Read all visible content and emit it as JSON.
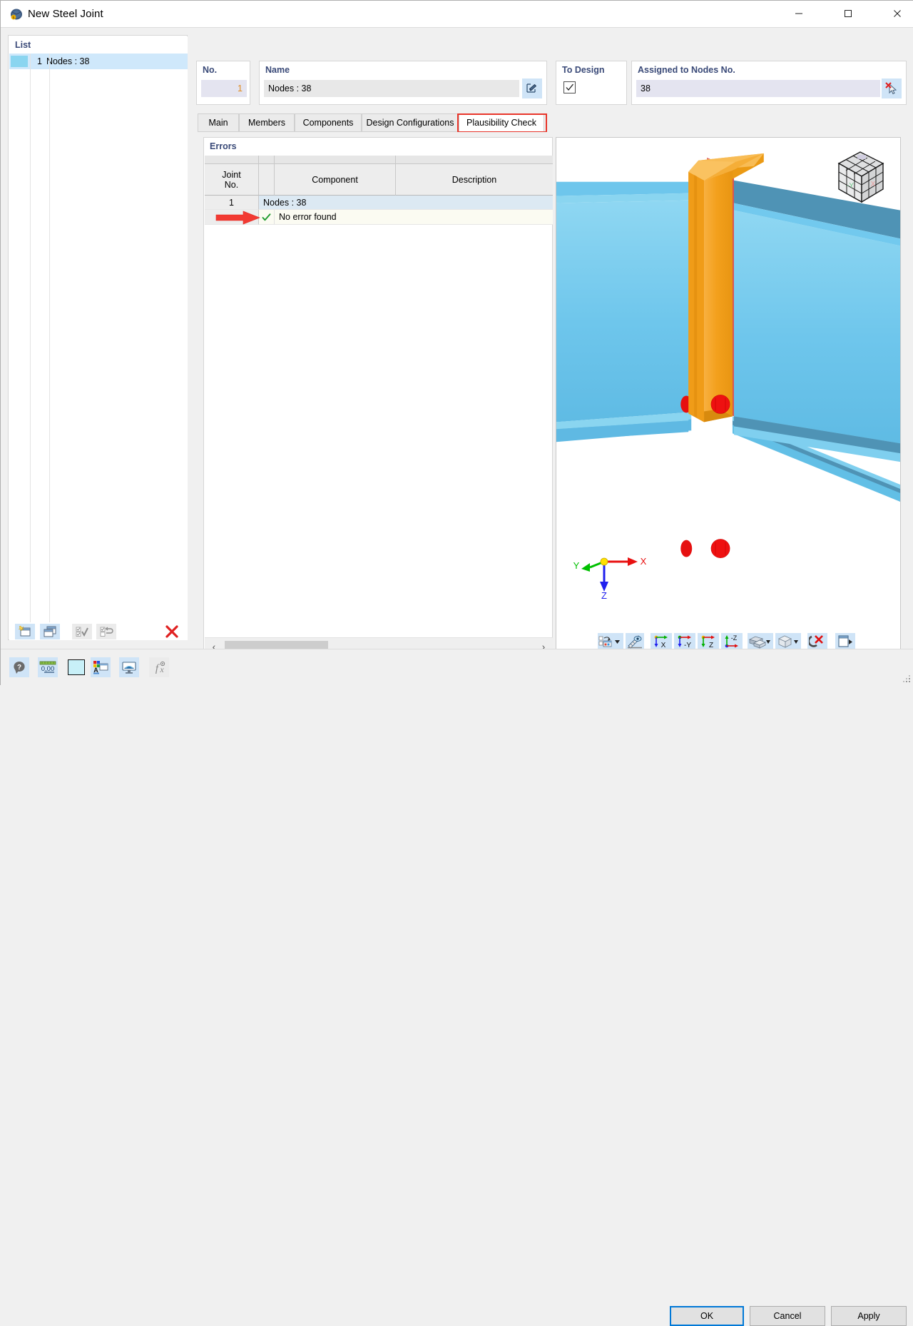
{
  "window": {
    "title": "New Steel Joint",
    "app_icon": "steel-joint-icon",
    "minimize_label": "─",
    "maximize_label": "☐",
    "close_label": "✕"
  },
  "list_panel": {
    "title": "List",
    "rows": [
      {
        "number": "1",
        "label": "Nodes : 38",
        "swatch_color": "#8ad5f0",
        "selected": true
      }
    ],
    "toolbar": [
      {
        "name": "new-joint-button",
        "icon": "new-window-icon",
        "enabled": true
      },
      {
        "name": "copy-joint-button",
        "icon": "copy-window-icon",
        "enabled": true
      },
      {
        "name": "select-all-button",
        "icon": "check-all-icon",
        "enabled": false
      },
      {
        "name": "invert-selection-button",
        "icon": "invert-selection-icon",
        "enabled": false
      },
      {
        "name": "delete-joint-button",
        "icon": "red-x-icon",
        "enabled": true
      }
    ]
  },
  "no_field": {
    "label": "No.",
    "value": "1"
  },
  "name_field": {
    "label": "Name",
    "value": "Nodes : 38",
    "edit_button_icon": "edit-pencil-icon"
  },
  "to_design": {
    "label": "To Design",
    "checked": true,
    "check_glyph": "✓"
  },
  "assigned_field": {
    "label": "Assigned to Nodes No.",
    "value": "38",
    "pick_button_icon": "pick-cursor-clear-icon"
  },
  "tabs": [
    {
      "label": "Main",
      "active": false
    },
    {
      "label": "Members",
      "active": false
    },
    {
      "label": "Components",
      "active": false
    },
    {
      "label": "Design Configurations",
      "active": false
    },
    {
      "label": "Plausibility Check",
      "active": true,
      "highlighted": true
    }
  ],
  "highlight_color": "#e8352a",
  "errors_panel": {
    "title": "Errors",
    "columns": [
      {
        "label": "Joint\nNo.",
        "line1": "Joint",
        "line2": "No."
      },
      {
        "label": ""
      },
      {
        "label": "Component"
      },
      {
        "label": "Description"
      }
    ],
    "rows": [
      {
        "type": "group",
        "joint_no": "1",
        "status_icon": "",
        "component": "Nodes : 38",
        "description": ""
      },
      {
        "type": "result",
        "joint_no": "",
        "status_icon": "green-check-icon",
        "status_glyph": "✔",
        "component": "No error found",
        "description": "",
        "annotation": "red-arrow-pointer"
      }
    ],
    "scroll_left_glyph": "‹",
    "scroll_right_glyph": "›"
  },
  "view3d": {
    "navigation_cube": "view-cube",
    "axis_labels": {
      "x": "X",
      "y": "Y",
      "z": "Z"
    },
    "axis_colors": {
      "x": "#e81010",
      "y": "#00c000",
      "z": "#2020ee"
    },
    "model": {
      "beam_color": "#6ec6ec",
      "beam_shade_color": "#4f93b5",
      "plate_color": "#f5a623",
      "bolt_color": "#ee1111",
      "weld_color": "#d9534f",
      "description": "Two blue I-beams meeting at right angle with orange end plate and red bolts"
    },
    "toolbar": [
      {
        "name": "display-properties-button",
        "icon": "display-properties-icon",
        "dropdown": true
      },
      {
        "name": "measure-button",
        "icon": "ruler-eye-icon",
        "dropdown": false
      },
      {
        "name": "view-in-x-button",
        "icon": "axis-x-icon",
        "label": "X",
        "dropdown": false
      },
      {
        "name": "view-in-y-button",
        "icon": "axis-y-icon",
        "label": "-Y",
        "dropdown": false
      },
      {
        "name": "view-in-z-button",
        "icon": "axis-z-icon",
        "label": "Z",
        "dropdown": false
      },
      {
        "name": "view-in-neg-z-button",
        "icon": "axis-neg-z-icon",
        "label": "-Z",
        "dropdown": false
      },
      {
        "name": "render-mode-button",
        "icon": "solid-blocks-icon",
        "dropdown": true
      },
      {
        "name": "projection-button",
        "icon": "wireframe-cube-icon",
        "dropdown": true
      },
      {
        "name": "clear-selection-button",
        "icon": "cursor-red-x-icon",
        "dropdown": false
      },
      {
        "name": "panel-toggle-button",
        "icon": "panel-expand-icon",
        "dropdown": false
      }
    ]
  },
  "bottom_toolbar": [
    {
      "name": "help-button",
      "icon": "help-bubble-icon",
      "enabled": true
    },
    {
      "name": "units-button",
      "icon": "decimal-places-icon",
      "label": "0,00",
      "enabled": true
    },
    {
      "name": "color-swatch-button",
      "icon": "color-swatch-icon",
      "color": "#c8f0f8",
      "enabled": true
    },
    {
      "name": "display-options-button",
      "icon": "color-palette-window-icon",
      "enabled": true
    },
    {
      "name": "graphic-settings-button",
      "icon": "monitor-icon",
      "enabled": true
    },
    {
      "name": "formula-button",
      "icon": "fx-icon",
      "label": "ƒx",
      "enabled": false
    }
  ],
  "dialog_buttons": {
    "ok": "OK",
    "cancel": "Cancel",
    "apply": "Apply"
  }
}
